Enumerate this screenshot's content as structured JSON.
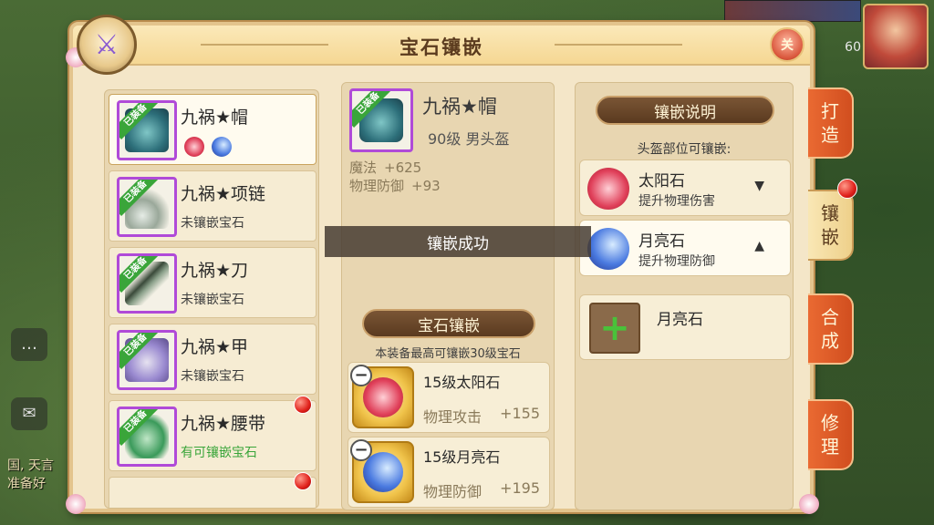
{
  "window": {
    "title": "宝石镶嵌"
  },
  "close_button_label": "关",
  "hud": {
    "level": "60"
  },
  "chat": {
    "line1": "国, 天言",
    "line2": "准备好"
  },
  "equipment_list": [
    {
      "name": "九祸★帽",
      "status": "",
      "equipped_tag": "已装备",
      "gems": [
        "sun",
        "moon"
      ],
      "selected": true
    },
    {
      "name": "九祸★项链",
      "status": "未镶嵌宝石",
      "equipped_tag": "已装备"
    },
    {
      "name": "九祸★刀",
      "status": "未镶嵌宝石",
      "equipped_tag": "已装备"
    },
    {
      "name": "九祸★甲",
      "status": "未镶嵌宝石",
      "equipped_tag": "已装备"
    },
    {
      "name": "九祸★腰带",
      "status": "有可镶嵌宝石",
      "equipped_tag": "已装备",
      "alert": true
    }
  ],
  "selected_item": {
    "name": "九祸★帽",
    "level_type": "90级  男头盔",
    "equipped_tag": "已装备",
    "stats": [
      {
        "label": "魔法",
        "value": "+625"
      },
      {
        "label": "物理防御",
        "value": "+93"
      }
    ]
  },
  "inlay_section": {
    "title": "宝石镶嵌",
    "note": "本装备最高可镶嵌30级宝石",
    "slots": [
      {
        "name": "15级太阳石",
        "stat": "物理攻击",
        "value": "+155",
        "gem": "sun"
      },
      {
        "name": "15级月亮石",
        "stat": "物理防御",
        "value": "+195",
        "gem": "moon"
      }
    ]
  },
  "toast": "镶嵌成功",
  "info_panel": {
    "title": "镶嵌说明",
    "subtitle": "头盔部位可镶嵌:",
    "gems": [
      {
        "name": "太阳石",
        "desc": "提升物理伤害",
        "arrow": "▼",
        "gem": "sun"
      },
      {
        "name": "月亮石",
        "desc": "提升物理防御",
        "arrow": "▲",
        "gem": "moon"
      }
    ],
    "add_label": "月亮石"
  },
  "side_tabs": [
    {
      "label_top": "打",
      "label_bottom": "造",
      "active": false
    },
    {
      "label_top": "镶",
      "label_bottom": "嵌",
      "active": true
    },
    {
      "label_top": "合",
      "label_bottom": "成",
      "active": false
    },
    {
      "label_top": "修",
      "label_bottom": "理",
      "active": false
    }
  ],
  "colors": {
    "accent_orange": "#d14e1f",
    "purple_border": "#b04ad8",
    "equipped_green": "#3aa53a",
    "available_green": "#3aa53a"
  }
}
